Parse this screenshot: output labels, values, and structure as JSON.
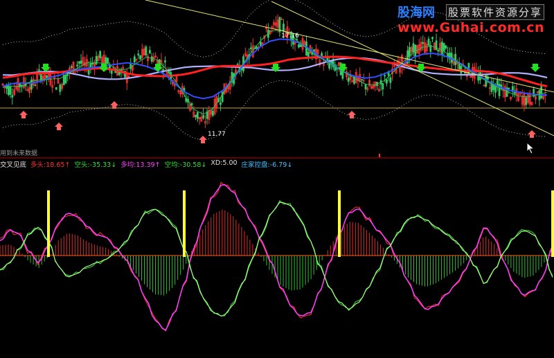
{
  "watermark": {
    "brand": "股海网",
    "slogan": "股票软件资源分享",
    "url": "www.Guhai.com.cn"
  },
  "price_panel": {
    "high_label": "17.16",
    "low_label": "11.77",
    "note_text": "用到未来数据",
    "price_range": [
      10.5,
      18.4
    ]
  },
  "indicator_panel": {
    "name": "交叉见底",
    "items": [
      {
        "label": "多头:",
        "value": "18.65",
        "arrow": "↑",
        "color": "#ff3030",
        "value_color": "#ff3030"
      },
      {
        "label": "空头:",
        "value": "-35.33",
        "arrow": "↓",
        "color": "#30e030",
        "value_color": "#30e030"
      },
      {
        "label": "多均:",
        "value": "13.39",
        "arrow": "↑",
        "color": "#ff40ff",
        "value_color": "#ff40ff"
      },
      {
        "label": "空均:",
        "value": "-30.58",
        "arrow": "↓",
        "color": "#30e030",
        "value_color": "#30e030"
      },
      {
        "label": "XD:",
        "value": "5.00",
        "arrow": "",
        "color": "#e0e0e0",
        "value_color": "#e0e0e0"
      },
      {
        "label": "庄家控盘:",
        "value": "-6.79",
        "arrow": "↓",
        "color": "#40c0ff",
        "value_color": "#40c0ff"
      }
    ]
  },
  "colors": {
    "background": "#000000",
    "up_candle": "#ff3333",
    "down_candle": "#33cc66",
    "ma_red": "#ff2020",
    "ma_blue": "#3050ff",
    "ma_lavender": "#b0b0ff",
    "trendline": "#e8e870",
    "signal_bar": "#ffff40",
    "long_line": "#ff40ff",
    "short_line": "#40ff40",
    "zero_line": "#ff6020",
    "divider": "#c00000"
  },
  "chart_data": [
    {
      "type": "line",
      "title": "",
      "series": [
        {
          "name": "",
          "values": [
            13.9,
            13.6,
            14.0,
            13.8,
            14.5,
            14.2,
            13.9,
            14.6,
            15.1,
            14.8,
            15.4,
            15.0,
            14.7,
            14.3,
            15.2,
            15.6,
            15.3,
            14.9,
            14.2,
            13.4,
            12.5,
            11.9,
            12.6,
            13.4,
            14.2,
            14.9,
            15.6,
            16.3,
            16.8,
            17.1,
            16.6,
            16.2,
            15.7,
            15.4,
            15.1,
            14.8,
            14.5,
            14.2,
            13.9,
            13.7,
            14.1,
            14.6,
            15.2,
            15.7,
            15.9,
            16.1,
            15.8,
            15.4,
            14.9,
            14.6,
            14.3,
            14.0,
            13.7,
            13.5,
            13.3,
            13.1,
            13.4,
            13.6
          ]
        }
      ],
      "markers": {
        "high": "17.16",
        "low": "11.77"
      }
    },
    {
      "type": "line",
      "title": "交叉见底",
      "ylim": [
        -120,
        120
      ],
      "series": [
        {
          "name": "多头",
          "values": [
            20,
            35,
            30,
            5,
            -10,
            15,
            45,
            60,
            55,
            40,
            30,
            25,
            10,
            -5,
            -30,
            -60,
            -90,
            -105,
            -80,
            -40,
            10,
            50,
            85,
            100,
            90,
            70,
            45,
            20,
            -10,
            -45,
            -70,
            -85,
            -80,
            -50,
            -10,
            30,
            60,
            65,
            50,
            35,
            20,
            -5,
            -35,
            -60,
            -75,
            -70,
            -55,
            -40,
            -20,
            10,
            40,
            25,
            -10,
            -40,
            -55,
            -50,
            -30,
            15
          ]
        },
        {
          "name": "空头",
          "values": [
            -20,
            -10,
            10,
            30,
            40,
            20,
            -15,
            -30,
            -25,
            -15,
            -10,
            -5,
            5,
            20,
            40,
            60,
            65,
            55,
            40,
            10,
            -30,
            -60,
            -80,
            -85,
            -70,
            -40,
            -5,
            30,
            60,
            75,
            70,
            50,
            20,
            -15,
            -45,
            -65,
            -75,
            -65,
            -45,
            -20,
            10,
            30,
            50,
            55,
            50,
            40,
            30,
            20,
            5,
            -15,
            -40,
            -20,
            5,
            25,
            35,
            30,
            10,
            -30
          ]
        },
        {
          "name": "XD",
          "values": [
            0,
            0,
            0,
            0,
            0,
            1,
            0,
            0,
            0,
            0,
            0,
            0,
            0,
            0,
            0,
            0,
            0,
            0,
            0,
            1,
            0,
            0,
            0,
            0,
            0,
            0,
            0,
            0,
            0,
            0,
            0,
            0,
            0,
            0,
            0,
            1,
            0,
            0,
            0,
            0,
            0,
            0,
            0,
            0,
            0,
            0,
            0,
            0,
            0,
            0,
            0,
            0,
            0,
            0,
            0,
            0,
            0,
            1
          ]
        }
      ]
    }
  ]
}
